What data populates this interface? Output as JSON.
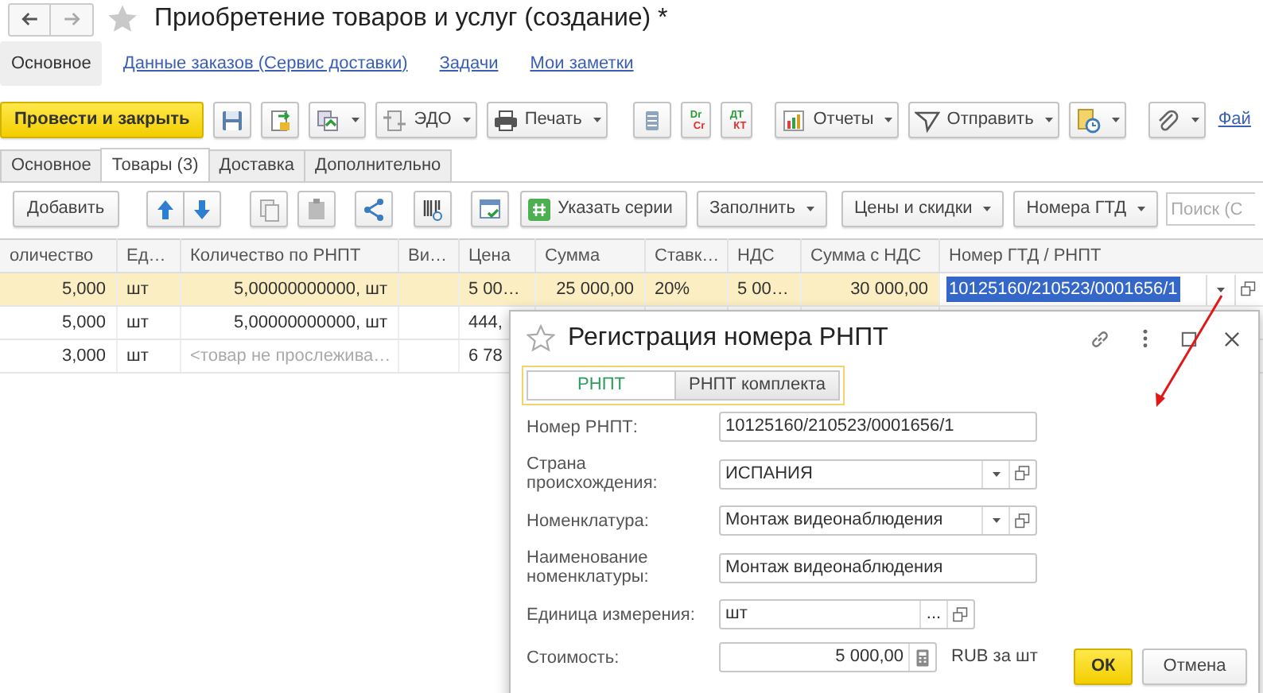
{
  "window": {
    "title": "Приобретение товаров и услуг (создание) *"
  },
  "nav_links": [
    {
      "label": "Основное",
      "selected": true
    },
    {
      "label": "Данные заказов (Сервис доставки)",
      "selected": false
    },
    {
      "label": "Задачи",
      "selected": false
    },
    {
      "label": "Мои заметки",
      "selected": false
    }
  ],
  "command_bar": [
    {
      "kind": "primary",
      "label": "Провести и закрыть"
    },
    {
      "kind": "save"
    },
    {
      "kind": "post"
    },
    {
      "kind": "related",
      "dropdown": true
    },
    {
      "kind": "edo",
      "label": "ЭДО",
      "dropdown": true
    },
    {
      "kind": "print",
      "label": "Печать",
      "dropdown": true
    },
    {
      "kind": "list"
    },
    {
      "kind": "dr-cr",
      "lines": [
        "Dr",
        "Cr"
      ]
    },
    {
      "kind": "dt-kt",
      "lines": [
        "ДТ",
        "КТ"
      ]
    },
    {
      "kind": "reports",
      "label": "Отчеты",
      "dropdown": true
    },
    {
      "kind": "send",
      "label": "Отправить",
      "dropdown": true
    },
    {
      "kind": "schedule",
      "dropdown": true
    },
    {
      "kind": "attach",
      "dropdown": true
    },
    {
      "kind": "link",
      "label": "Фай"
    }
  ],
  "tabs": [
    {
      "label": "Основное",
      "selected": false
    },
    {
      "label": "Товары (3)",
      "selected": true
    },
    {
      "label": "Доставка",
      "selected": false
    },
    {
      "label": "Дополнительно",
      "selected": false
    }
  ],
  "table_toolbar": [
    {
      "kind": "text",
      "label": "Добавить"
    },
    {
      "kind": "move-up"
    },
    {
      "kind": "move-down"
    },
    {
      "kind": "copy"
    },
    {
      "kind": "paste"
    },
    {
      "kind": "share"
    },
    {
      "kind": "barcode"
    },
    {
      "kind": "check"
    },
    {
      "kind": "series",
      "label": "Указать серии"
    },
    {
      "kind": "menu",
      "label": "Заполнить",
      "dropdown": true
    },
    {
      "kind": "menu",
      "label": "Цены и скидки",
      "dropdown": true
    },
    {
      "kind": "menu",
      "label": "Номера ГТД",
      "dropdown": true
    },
    {
      "kind": "search",
      "placeholder": "Поиск (С"
    }
  ],
  "table": {
    "columns": [
      "оличество",
      "Ед…",
      "Количество по РНПТ",
      "Ви…",
      "Цена",
      "Сумма",
      "Ставк…",
      "НДС",
      "Сумма с НДС",
      "Номер ГТД / РНПТ"
    ],
    "rows": [
      {
        "selected": true,
        "tracked": true,
        "cells": [
          "5,000",
          "шт",
          "5,00000000000, шт",
          "",
          "5 00…",
          "25 000,00",
          "20%",
          "5 00…",
          "30 000,00",
          "10125160/210523/0001656/1"
        ]
      },
      {
        "selected": false,
        "tracked": true,
        "cells": [
          "5,000",
          "шт",
          "5,00000000000, шт",
          "",
          "444,"
        ]
      },
      {
        "selected": false,
        "tracked": false,
        "cells": [
          "3,000",
          "шт",
          "<товар не прослежива…",
          "",
          "6 78"
        ]
      }
    ]
  },
  "dialog": {
    "title": "Регистрация номера РНПТ",
    "tabs": [
      {
        "label": "РНПТ",
        "selected": true
      },
      {
        "label": "РНПТ комплекта",
        "selected": false
      }
    ],
    "fields": [
      {
        "kind": "text",
        "label": "Номер РНПТ:",
        "value": "10125160/210523/0001656/1"
      },
      {
        "kind": "select",
        "label": "Страна происхождения:",
        "value": "ИСПАНИЯ"
      },
      {
        "kind": "select",
        "label": "Номенклатура:",
        "value": "Монтаж видеонаблюдения"
      },
      {
        "kind": "text",
        "label": "Наименование номенклатуры:",
        "value": "Монтаж видеонаблюдения"
      },
      {
        "kind": "choice",
        "label": "Единица измерения:",
        "value": "шт",
        "button_text": "..."
      },
      {
        "kind": "number",
        "label": "Стоимость:",
        "value": "5 000,00",
        "suffix": "RUB за шт"
      }
    ],
    "buttons": [
      {
        "label": "ОК",
        "primary": true
      },
      {
        "label": "Отмена",
        "primary": false
      }
    ]
  }
}
